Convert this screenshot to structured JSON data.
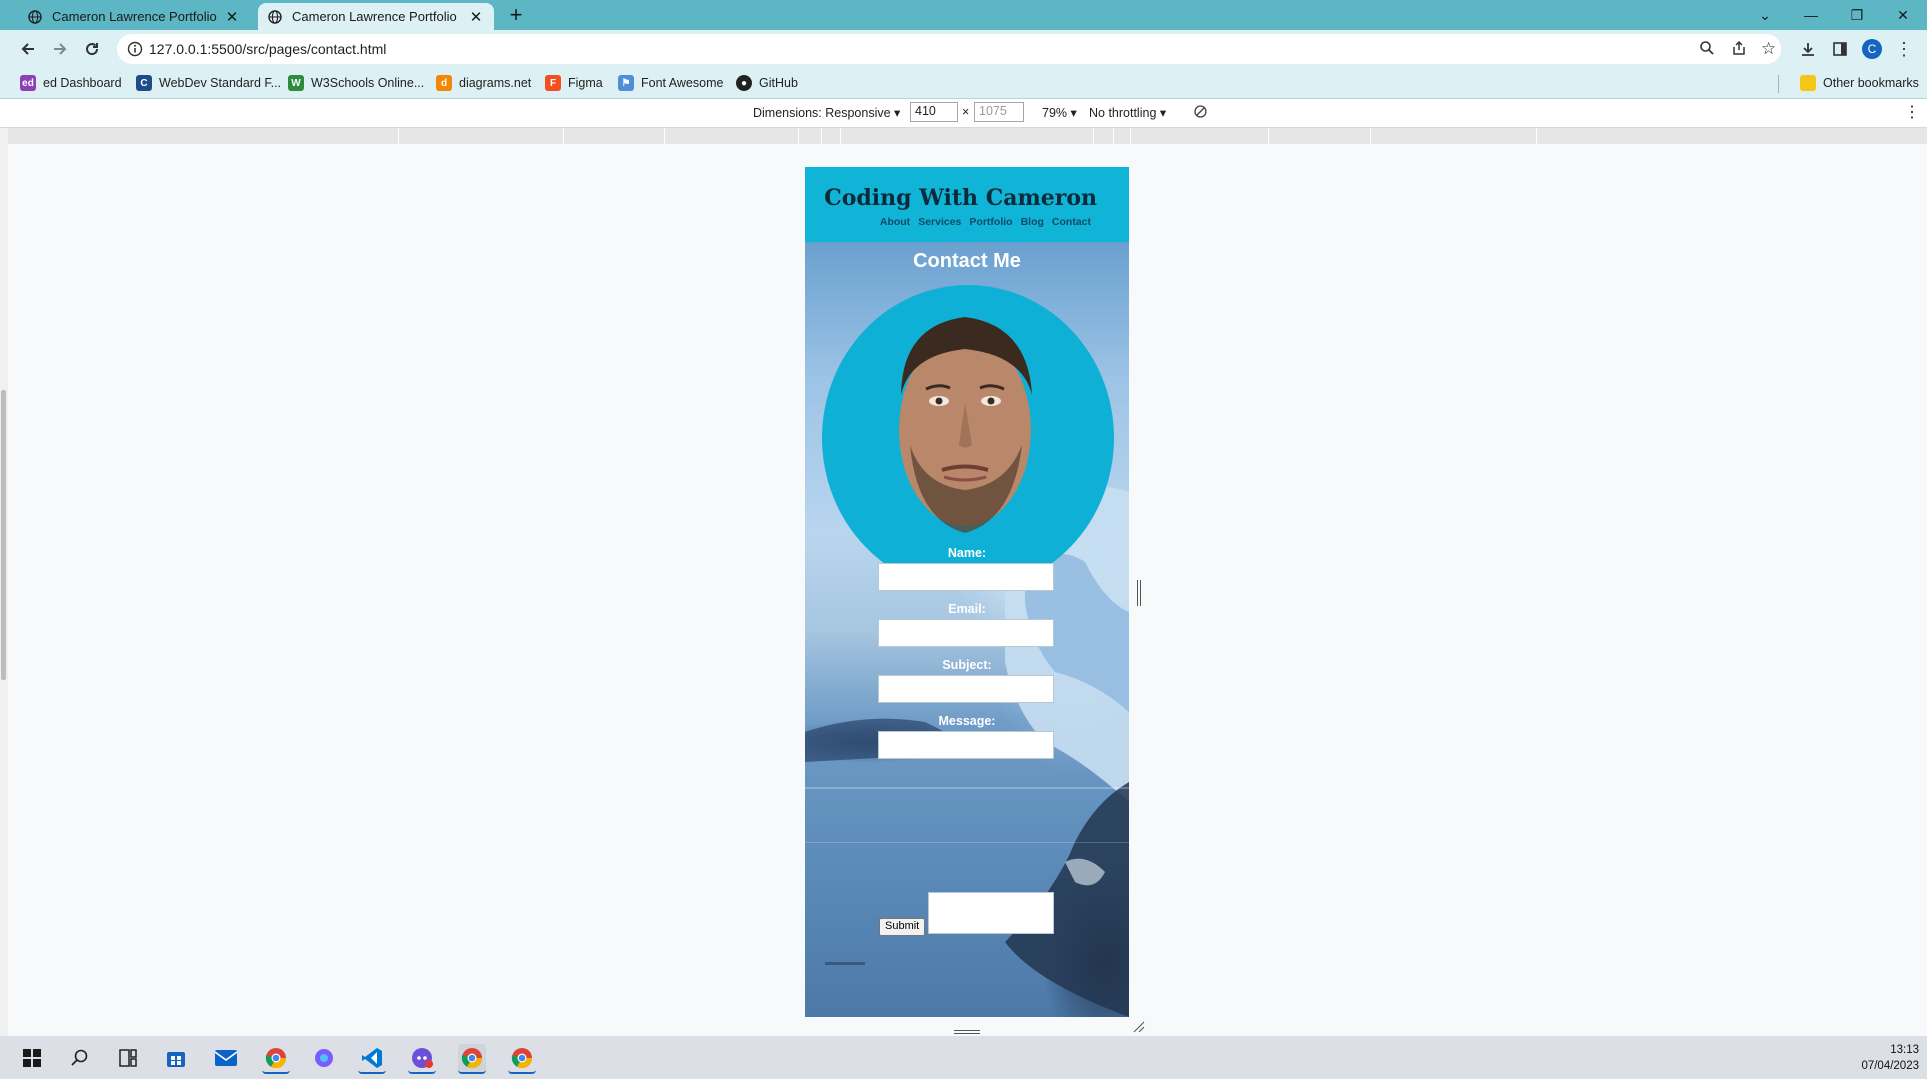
{
  "browser": {
    "tabs": [
      {
        "title": "Cameron Lawrence Portfolio",
        "active": false
      },
      {
        "title": "Cameron Lawrence Portfolio",
        "active": true
      }
    ],
    "new_tab": "+",
    "window_controls": {
      "dropdown": "⌄",
      "minimize": "—",
      "restore": "❐",
      "close": "✕"
    },
    "url": "127.0.0.1:5500/src/pages/contact.html",
    "profile_initial": "C",
    "bookmarks": [
      {
        "label": "ed Dashboard",
        "icon": "ed-icon",
        "glyph": "ed",
        "color": "#8e3fb6"
      },
      {
        "label": "WebDev Standard F...",
        "icon": "webdev-icon",
        "glyph": "C",
        "color": "#1e4c8a"
      },
      {
        "label": "W3Schools Online...",
        "icon": "w3schools-icon",
        "glyph": "W",
        "color": "#2e8b3d"
      },
      {
        "label": "diagrams.net",
        "icon": "diagrams-icon",
        "glyph": "d",
        "color": "#f08705"
      },
      {
        "label": "Figma",
        "icon": "figma-icon",
        "glyph": "F",
        "color": "#f24e1e"
      },
      {
        "label": "Font Awesome",
        "icon": "font-awesome-icon",
        "glyph": "⚑",
        "color": "#528dd7"
      },
      {
        "label": "GitHub",
        "icon": "github-icon",
        "glyph": "●",
        "color": "#222222"
      }
    ],
    "other_bookmarks": "Other bookmarks"
  },
  "devtools": {
    "dimensions_label": "Dimensions: Responsive",
    "width": "410",
    "height": "1075",
    "times": "×",
    "zoom": "79%",
    "throttling": "No throttling"
  },
  "site": {
    "title": "Coding With Cameron",
    "nav": [
      "About",
      "Services",
      "Portfolio",
      "Blog",
      "Contact"
    ],
    "heading": "Contact Me",
    "form": {
      "labels": [
        "Name:",
        "Email:",
        "Subject:",
        "Message:"
      ],
      "submit": "Submit"
    },
    "colors": {
      "header": "#10b4d6",
      "title": "#0c2a3a",
      "nav": "#114a68",
      "portrait_bg": "#0fb0d6"
    }
  },
  "taskbar": {
    "apps": [
      "start-icon",
      "search-icon",
      "task-view-icon",
      "store-icon",
      "mail-icon",
      "chrome-icon",
      "copilot-icon",
      "vscode-icon",
      "discord-icon",
      "chrome-icon",
      "chrome-icon"
    ],
    "time": "13:13",
    "date": "07/04/2023"
  }
}
